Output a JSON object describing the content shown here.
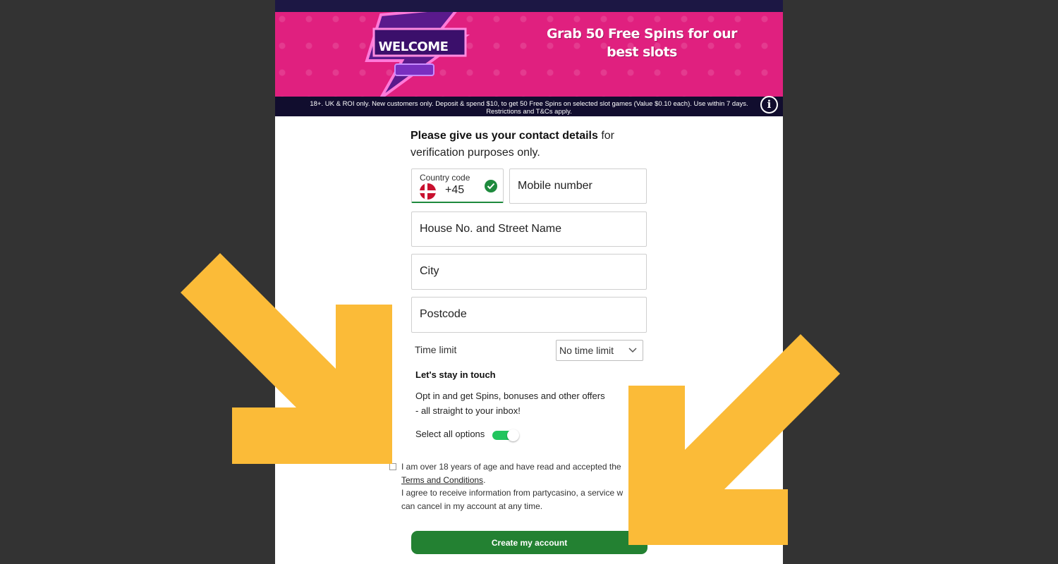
{
  "banner": {
    "welcome": "WELCOME",
    "promo_line1": "Grab 50 Free Spins for our",
    "promo_line2": "best slots",
    "disclaimer": "18+. UK & ROI only. New customers only. Deposit & spend $10, to get 50 Free Spins on selected slot games (Value $0.10 each). Use within 7 days. Restrictions and T&Cs apply."
  },
  "intro": {
    "bold": "Please give us your contact details",
    "rest": " for verification purposes only."
  },
  "form": {
    "country_code_label": "Country code",
    "country_code_value": "+45",
    "mobile_placeholder": "Mobile number",
    "address_placeholder": "House No. and Street Name",
    "city_placeholder": "City",
    "postcode_placeholder": "Postcode",
    "time_limit_label": "Time limit",
    "time_limit_value": "No time limit"
  },
  "marketing": {
    "title": "Let's stay in touch",
    "line1": "Opt in and get Spins, bonuses and other offers",
    "line2": "- all straight to your inbox!",
    "select_all_label": "Select all options",
    "select_all_on": true
  },
  "consent": {
    "line1": "I am over 18 years of age and have read and accepted the",
    "terms_link": "Terms and Conditions",
    "terms_suffix": ".",
    "line2": "I agree to receive information from partycasino, a service w",
    "line3": "can cancel in my account at any time."
  },
  "actions": {
    "create_label": "Create my account"
  },
  "colors": {
    "banner_pink": "#e0207f",
    "success_green": "#1e8a3d",
    "button_green": "#238132",
    "annotation_arrow": "#fbbb38"
  }
}
